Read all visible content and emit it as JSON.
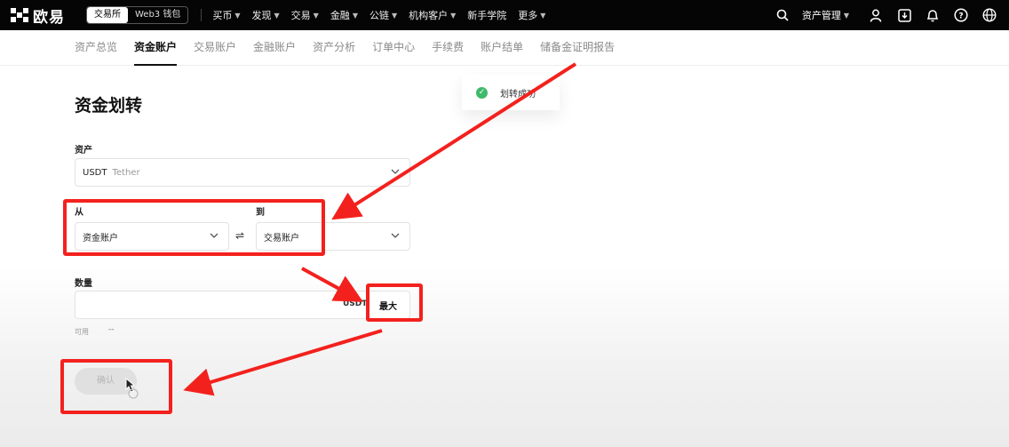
{
  "brand": {
    "logo_text": "欧易"
  },
  "mode_switch": {
    "exchange": "交易所",
    "web3": "Web3 钱包"
  },
  "top_nav": [
    "买币",
    "发现",
    "交易",
    "金融",
    "公链",
    "机构客户",
    "新手学院",
    "更多"
  ],
  "top_nav_no_chevron": [
    false,
    false,
    false,
    false,
    false,
    false,
    true,
    false
  ],
  "header_right": {
    "asset_management": "资产管理"
  },
  "sub_nav": [
    "资产总览",
    "资金账户",
    "交易账户",
    "金融账户",
    "资产分析",
    "订单中心",
    "手续费",
    "账户结单",
    "储备金证明报告"
  ],
  "sub_nav_active_index": 1,
  "toast": {
    "text": "划转成功"
  },
  "transfer": {
    "title": "资金划转",
    "asset_label": "资产",
    "asset_value": "USDT",
    "asset_name": "Tether",
    "from_label": "从",
    "from_value": "资金账户",
    "to_label": "到",
    "to_value": "交易账户",
    "swap_symbol": "⇌",
    "amount_label": "数量",
    "unit": "USDT",
    "max_label": "最大",
    "available_label": "可用",
    "available_value": "--",
    "confirm_label": "确认"
  },
  "colors": {
    "highlight": "#f3211d",
    "success": "#3fb96b"
  }
}
